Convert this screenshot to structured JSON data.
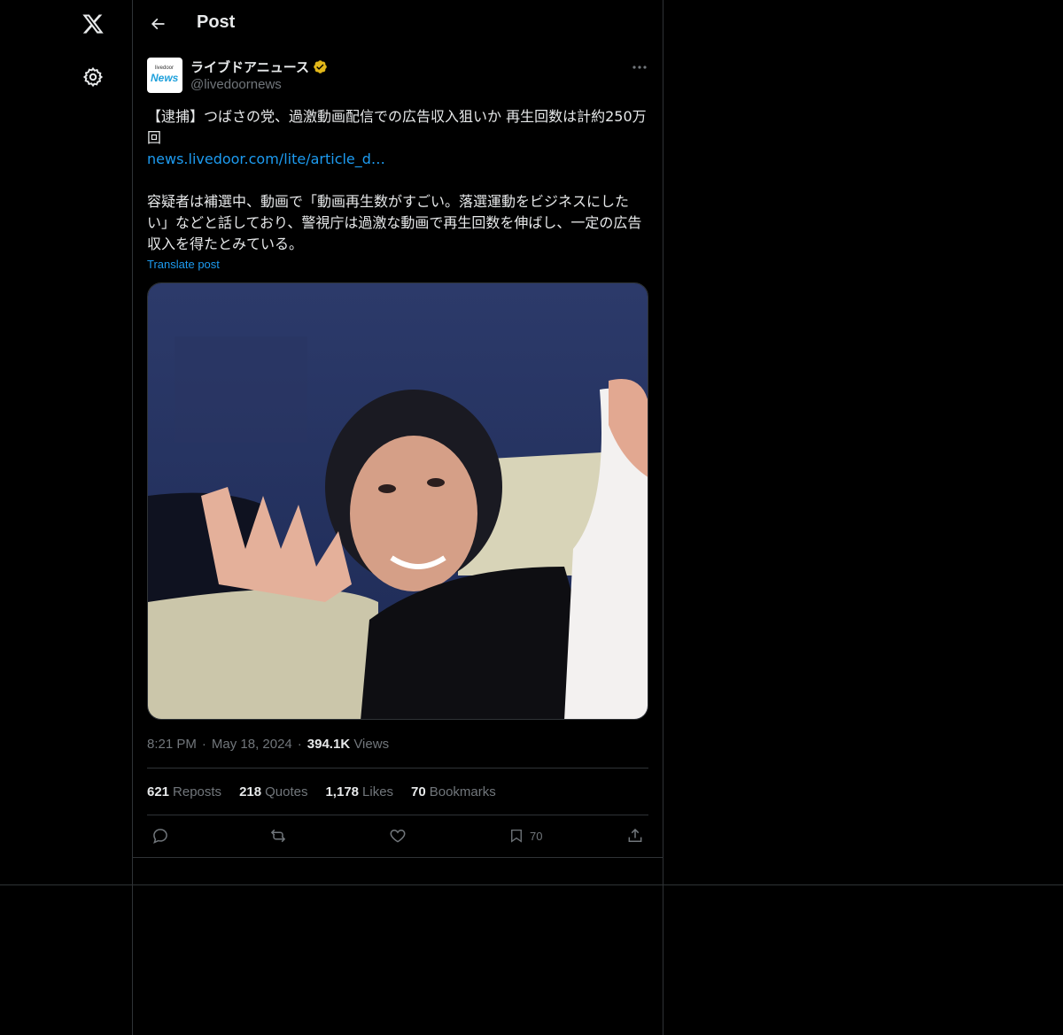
{
  "nav": {
    "logo_icon": "x-logo-icon",
    "settings_icon": "gear-icon"
  },
  "header": {
    "title": "Post",
    "back_icon": "back-arrow-icon"
  },
  "post": {
    "author": {
      "avatar_text_small": "livedoor",
      "avatar_text_big": "News",
      "display_name": "ライブドアニュース",
      "handle": "@livedoornews",
      "verified_color": "#e2b719"
    },
    "text_line1": "【逮捕】つばさの党、過激動画配信での広告収入狙いか 再生回数は計約250万回",
    "link": "news.livedoor.com/lite/article_d…",
    "text_paragraph2": "容疑者は補選中、動画で「動画再生数がすごい。落選運動をビジネスにしたい」などと話しており、警視庁は過激な動画で再生回数を伸ばし、一定の広告収入を得たとみている。",
    "translate": "Translate post",
    "time": "8:21 PM",
    "date": "May 18, 2024",
    "views_count": "394.1K",
    "views_label": "Views",
    "stats": {
      "reposts_count": "621",
      "reposts_label": "Reposts",
      "quotes_count": "218",
      "quotes_label": "Quotes",
      "likes_count": "1,178",
      "likes_label": "Likes",
      "bookmarks_count": "70",
      "bookmarks_label": "Bookmarks"
    },
    "actions": {
      "bookmark_count": "70"
    }
  },
  "colors": {
    "background": "#000000",
    "border": "#2f3336",
    "link": "#1d9bf0",
    "muted": "#71767b",
    "text": "#e7e9ea"
  }
}
